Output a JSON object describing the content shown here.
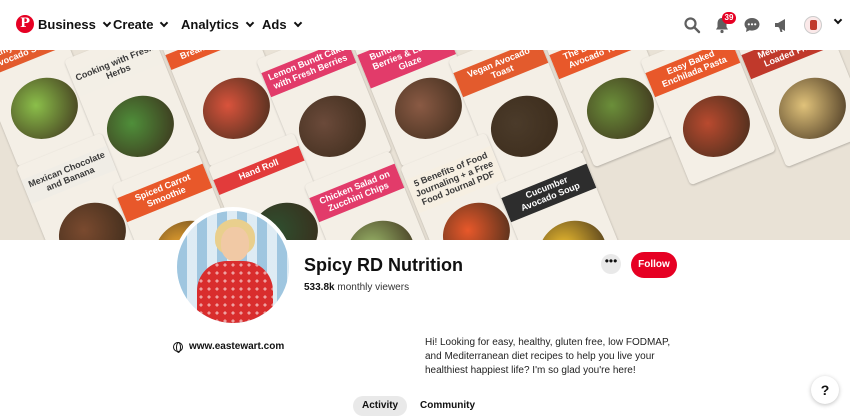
{
  "nav": {
    "logo": "P",
    "items": [
      {
        "label": "Business"
      },
      {
        "label": "Create"
      },
      {
        "label": "Analytics"
      },
      {
        "label": "Ads"
      }
    ],
    "notification_count": "39",
    "icons": [
      "search-icon",
      "bell-icon",
      "chat-icon",
      "megaphone-icon"
    ]
  },
  "cover": {
    "tiles": [
      {
        "text": "Dreamy Cucumber Avocado Soup",
        "color": "#e35b2d",
        "food": "#8bbf4a"
      },
      {
        "text": "Cooking with Fresh Herbs",
        "color": "#f3efe6",
        "food": "#4f8f3a"
      },
      {
        "text": "Breakfast Bowl",
        "color": "#e8582a",
        "food": "#d9533c"
      },
      {
        "text": "Lemon Bundt Cake with Fresh Berries",
        "color": "#e23b6a",
        "food": "#6b4a3a"
      },
      {
        "text": "Bundt Cake with Berries & Lemon Glaze",
        "color": "#e23b6a",
        "food": "#8a5a44"
      },
      {
        "text": "Vegan Avocado Toast",
        "color": "#e35b2d",
        "food": "#4b3b2a"
      },
      {
        "text": "The Best Vegan Avocado Toast",
        "color": "#e8582a",
        "food": "#6b8f3a"
      },
      {
        "text": "Easy Baked Enchilada Pasta",
        "color": "#e8582a",
        "food": "#b94a2f"
      },
      {
        "text": "Mediterranean Loaded Fries",
        "color": "#c0392b",
        "food": "#e0c27a"
      },
      {
        "text": "Mexican Chocolate and Banana",
        "color": "#f0ede6",
        "food": "#7a4a2f"
      },
      {
        "text": "Spiced Carrot Smoothie",
        "color": "#e8582a",
        "food": "#f0a830"
      },
      {
        "text": "Hand Roll",
        "color": "#e23b3b",
        "food": "#2f4f2f"
      },
      {
        "text": "Chicken Salad on Zucchini Chips",
        "color": "#e23b6a",
        "food": "#9bb86a"
      },
      {
        "text": "5 Benefits of Food Journaling + a Free Food Journal PDF",
        "color": "#f6efe2",
        "food": "#e8582a"
      },
      {
        "text": "Cucumber Avocado Soup",
        "color": "#2d2d2d",
        "food": "#f0c030"
      }
    ]
  },
  "profile": {
    "name": "Spicy RD Nutrition",
    "viewers_count": "533.8k",
    "viewers_label": "monthly viewers",
    "more_label": "•••",
    "follow_label": "Follow",
    "website": "www.eastewart.com",
    "bio": "Hi! Looking for easy, healthy, gluten free, low FODMAP, and Mediterranean diet recipes to help you live your healthiest happiest life? I'm so glad you're here!"
  },
  "tabs": [
    {
      "label": "Activity"
    },
    {
      "label": "Community"
    }
  ],
  "help_label": "?",
  "colors": {
    "brand": "#e60023"
  }
}
